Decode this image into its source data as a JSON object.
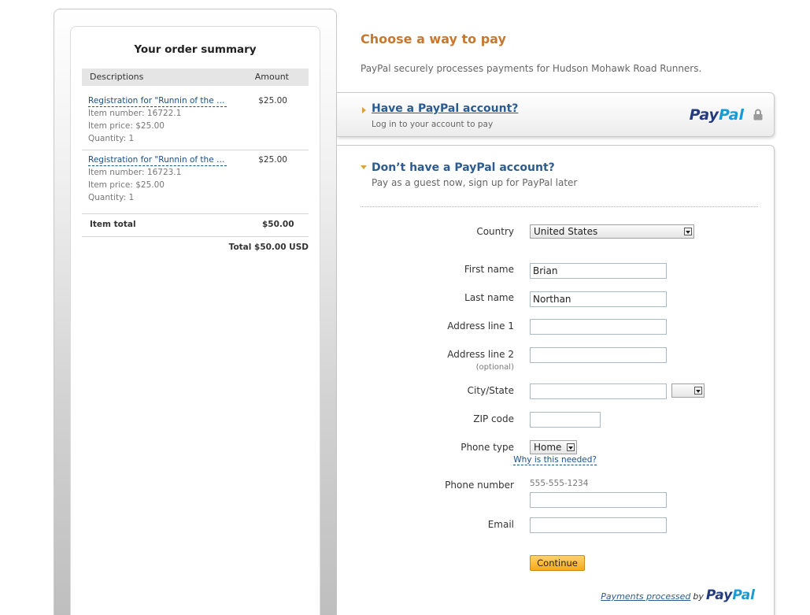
{
  "order_summary": {
    "title": "Your order summary",
    "col_descriptions": "Descriptions",
    "col_amount": "Amount",
    "items": [
      {
        "name": "Registration for \"Runnin of the Gre...",
        "price": "$25.00",
        "item_number": "Item number: 16722.1",
        "item_price": "Item price: $25.00",
        "quantity": "Quantity: 1"
      },
      {
        "name": "Registration for \"Runnin of the Gre...",
        "price": "$25.00",
        "item_number": "Item number: 16723.1",
        "item_price": "Item price: $25.00",
        "quantity": "Quantity: 1"
      }
    ],
    "item_total_label": "Item total",
    "item_total_value": "$50.00",
    "total": "Total $50.00 USD"
  },
  "payment": {
    "title": "Choose a way to pay",
    "subtitle": "PayPal securely processes payments for Hudson Mohawk Road Runners.",
    "account": {
      "title": "Have a PayPal account?",
      "subtitle": "Log in to your account to pay",
      "logo_part1": "Pay",
      "logo_part2": "Pal"
    },
    "guest": {
      "title": "Don’t have a PayPal account?",
      "subtitle": "Pay as a guest now, sign up for PayPal later"
    }
  },
  "form": {
    "country_label": "Country",
    "country_value": "United States",
    "first_name_label": "First name",
    "first_name_value": "Brian",
    "last_name_label": "Last name",
    "last_name_value": "Northan",
    "address1_label": "Address line 1",
    "address1_value": "",
    "address2_label": "Address line 2",
    "address2_note": "(optional)",
    "address2_value": "",
    "city_state_label": "City/State",
    "city_value": "",
    "state_value": "",
    "zip_label": "ZIP code",
    "zip_value": "",
    "phone_type_label": "Phone type",
    "phone_type_value": "Home",
    "why_link": "Why is this needed?",
    "phone_number_label": "Phone number",
    "phone_hint": "555-555-1234",
    "phone_value": "",
    "email_label": "Email",
    "email_value": "",
    "continue_label": "Continue"
  },
  "footer": {
    "processed_link": "Payments processed",
    "by": "by",
    "logo_part1": "Pay",
    "logo_part2": "Pal"
  },
  "colors": {
    "accent_title": "#c7782e",
    "link_blue": "#2c5b8f",
    "paypal_dark": "#253b80",
    "paypal_light": "#179bd7",
    "button_gold": "#f7a91a"
  },
  "icons": [
    "triangle-right-icon",
    "triangle-down-icon",
    "lock-icon",
    "dropdown-arrow-icon"
  ]
}
